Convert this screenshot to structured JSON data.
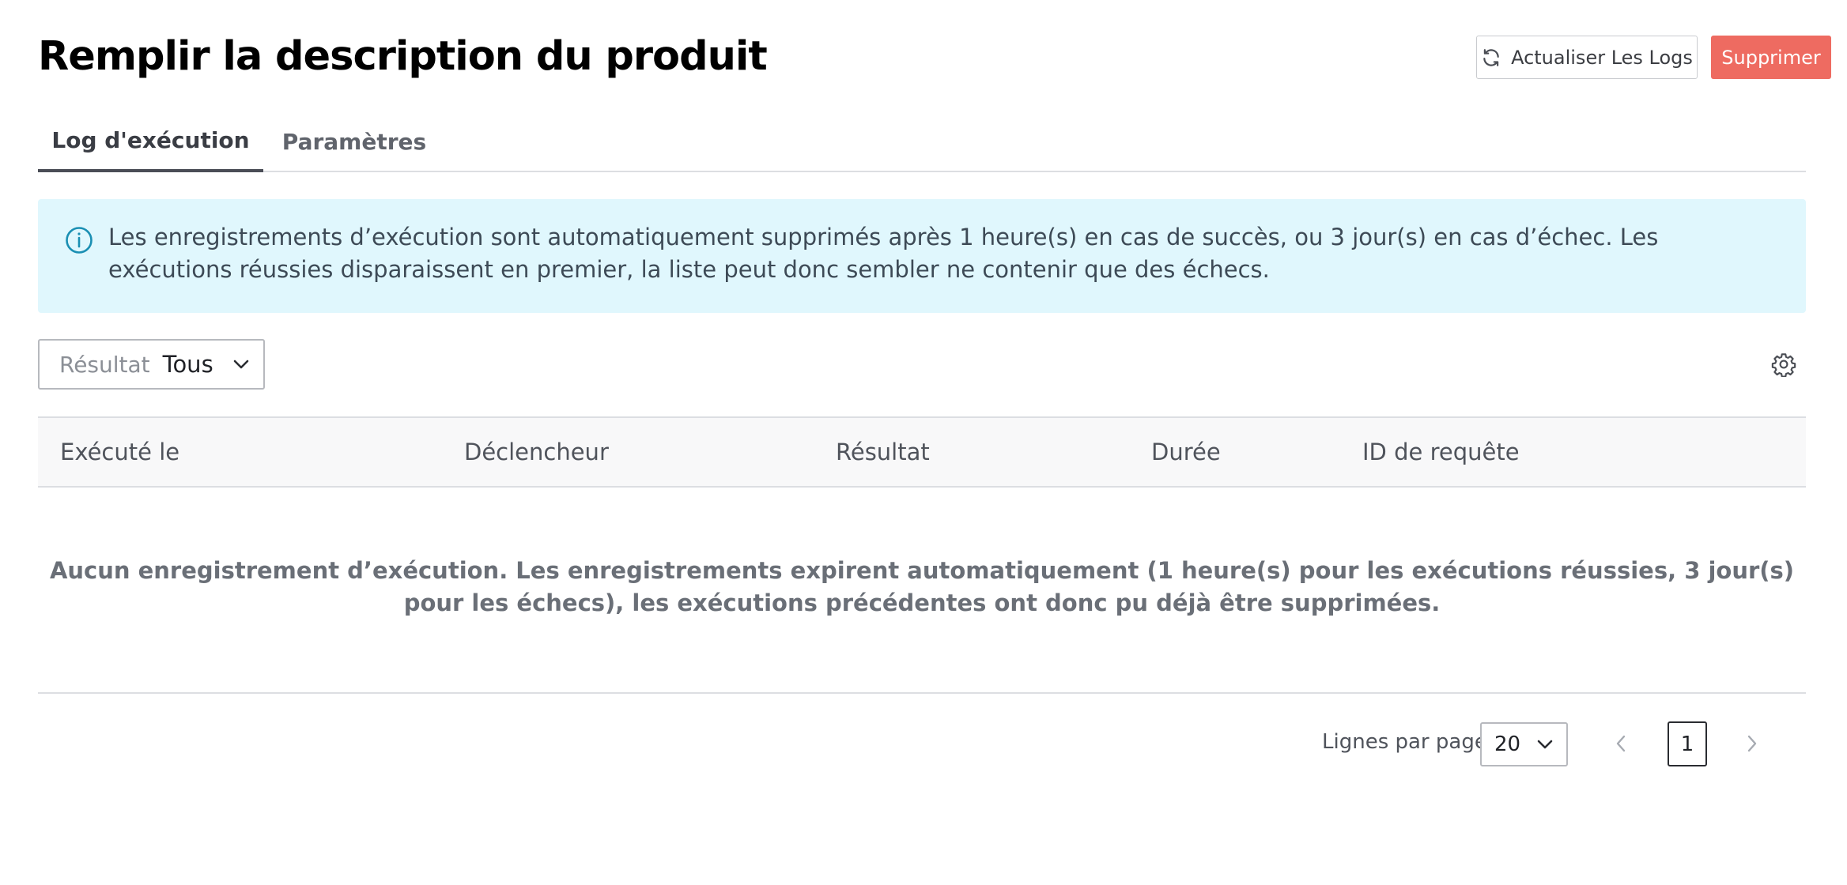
{
  "page": {
    "title": "Remplir la description du produit"
  },
  "header": {
    "refresh_label": "Actualiser Les Logs",
    "delete_label": "Supprimer",
    "delete_color": "#ee6b61"
  },
  "tabs": [
    {
      "label": "Log d'exécution",
      "active": true
    },
    {
      "label": "Paramètres",
      "active": false
    }
  ],
  "alert": {
    "icon": "info-icon",
    "text": "Les enregistrements d’exécution sont automatiquement supprimés après 1 heure(s) en cas de succès, ou 3 jour(s) en cas d’échec. Les exécutions réussies disparaissent en premier, la liste peut donc sembler ne contenir que des échecs.",
    "background": "#e0f7fd"
  },
  "filter": {
    "label": "Résultat",
    "value": "Tous"
  },
  "table": {
    "columns": [
      "Exécuté le",
      "Déclencheur",
      "Résultat",
      "Durée",
      "ID de requête"
    ],
    "rows": [],
    "empty_text": "Aucun enregistrement d’exécution. Les enregistrements expirent automatiquement (1 heure(s) pour les exécutions réussies, 3 jour(s) pour les échecs), les exécutions précédentes ont donc pu déjà être supprimées."
  },
  "pagination": {
    "rows_per_page_label": "Lignes par page",
    "rows_per_page": "20",
    "current_page": "1"
  }
}
